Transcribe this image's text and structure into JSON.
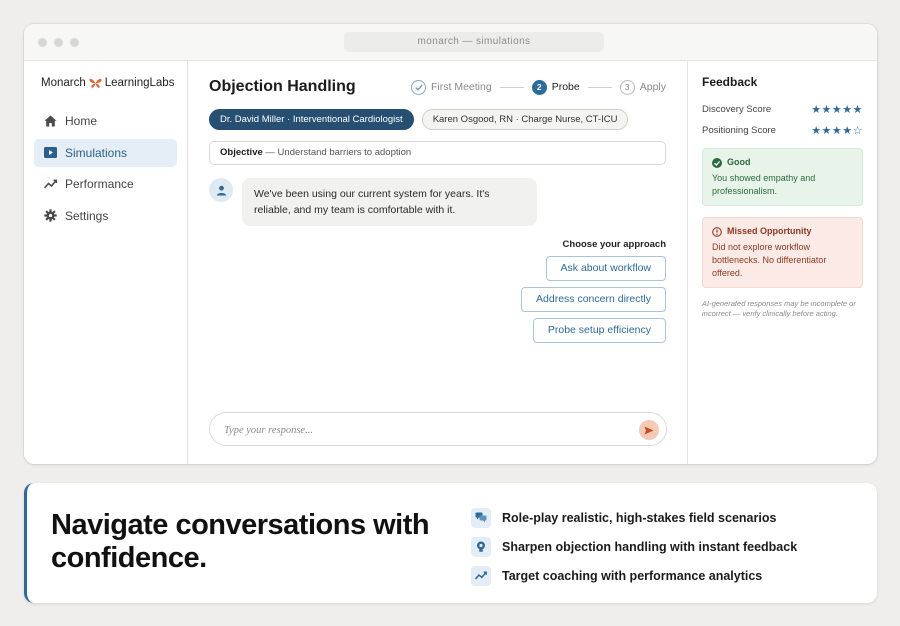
{
  "window": {
    "url": "monarch — simulations"
  },
  "brand": {
    "name_left": "Monarch",
    "name_right": "LearningLabs",
    "accent_color": "#e0663a"
  },
  "sidebar": {
    "items": [
      {
        "label": "Home",
        "icon": "home-icon",
        "active": false
      },
      {
        "label": "Simulations",
        "icon": "play-icon",
        "active": true
      },
      {
        "label": "Performance",
        "icon": "trend-icon",
        "active": false
      },
      {
        "label": "Settings",
        "icon": "gear-icon",
        "active": false
      }
    ]
  },
  "main": {
    "title": "Objection Handling",
    "steps": [
      {
        "num": "",
        "label": "First Meeting",
        "state": "done"
      },
      {
        "num": "2",
        "label": "Probe",
        "state": "current"
      },
      {
        "num": "3",
        "label": "Apply",
        "state": "upcoming"
      }
    ],
    "personas": [
      {
        "label": "Dr. David Miller · Interventional Cardiologist",
        "active": true
      },
      {
        "label": "Karen Osgood, RN · Charge Nurse, CT-ICU",
        "active": false
      }
    ],
    "objective": {
      "label": "Objective",
      "text": "— Understand barriers to adoption"
    },
    "message": "We've been using our current system for years. It's reliable, and my team is comfortable with it.",
    "approach_title": "Choose your approach",
    "choices": [
      "Ask about workflow",
      "Address concern directly",
      "Probe setup efficiency"
    ],
    "composer_placeholder": "Type your response..."
  },
  "feedback": {
    "title": "Feedback",
    "scores": [
      {
        "label": "Discovery Score",
        "stars": "★★★★★",
        "value": 5,
        "max": 5
      },
      {
        "label": "Positioning Score",
        "stars": "★★★★☆",
        "value": 4,
        "max": 5
      }
    ],
    "good": {
      "title": "Good",
      "text": "You showed empathy and professionalism."
    },
    "missed": {
      "title": "Missed Opportunity",
      "text": "Did not explore workflow bottlenecks. No differentiator offered."
    },
    "disclaimer": "AI-generated responses may be incomplete or incorrect — verify clinically before acting."
  },
  "promo": {
    "headline": "Navigate conversations with confidence.",
    "features": [
      {
        "icon": "chat-icon",
        "text": "Role-play realistic, high-stakes field scenarios"
      },
      {
        "icon": "lightbulb-icon",
        "text": "Sharpen objection handling with instant feedback"
      },
      {
        "icon": "trend-icon",
        "text": "Target coaching with performance analytics"
      }
    ]
  },
  "colors": {
    "primary": "#2e6a99",
    "persona_active": "#264f72",
    "good": "#2b6b3d",
    "missed": "#8c3a22",
    "send": "#f6c8b6"
  }
}
